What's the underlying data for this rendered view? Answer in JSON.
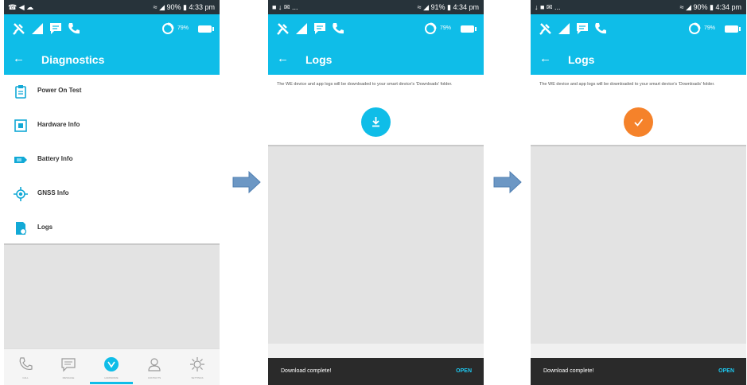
{
  "colors": {
    "accent": "#0fbde8",
    "statusbar": "#27333a",
    "success": "#f5822a",
    "arrow": "#6c97c4"
  },
  "screens": [
    {
      "status_left": "☎ ◀ ☁",
      "status_right": "≈ ◢ 90% ▮ 4:33 pm",
      "battery_pct": "79%",
      "back_icon": "←",
      "title": "Diagnostics",
      "menu": [
        {
          "label": "Power On Test",
          "icon": "clipboard-icon"
        },
        {
          "label": "Hardware Info",
          "icon": "chip-icon"
        },
        {
          "label": "Battery Info",
          "icon": "battery-icon"
        },
        {
          "label": "GNSS Info",
          "icon": "gps-icon"
        },
        {
          "label": "Logs",
          "icon": "logs-icon"
        }
      ],
      "bottom_nav": [
        {
          "label": "CALL",
          "icon": "phone-icon"
        },
        {
          "label": "MESSAGE",
          "icon": "message-icon"
        },
        {
          "label": "HARDWARE",
          "icon": "hardware-icon"
        },
        {
          "label": "CONTACTS",
          "icon": "contacts-icon"
        },
        {
          "label": "SETTINGS",
          "icon": "settings-icon"
        }
      ]
    },
    {
      "status_left": "■ ↓ ✉ ...",
      "status_right": "≈ ◢ 91% ▮ 4:34 pm",
      "battery_pct": "79%",
      "back_icon": "←",
      "title": "Logs",
      "description": "The WE device and app logs will be downloaded to your smart device's 'Downloads' folder.",
      "button_icon": "download-icon",
      "snackbar_text": "Download complete!",
      "snackbar_action": "OPEN"
    },
    {
      "status_left": "↓ ■ ✉ ...",
      "status_right": "≈ ◢ 90% ▮ 4:34 pm",
      "battery_pct": "79%",
      "back_icon": "←",
      "title": "Logs",
      "description": "The WE device and app logs will be downloaded to your smart device's 'Downloads' folder.",
      "button_icon": "check-icon",
      "snackbar_text": "Download complete!",
      "snackbar_action": "OPEN"
    }
  ]
}
